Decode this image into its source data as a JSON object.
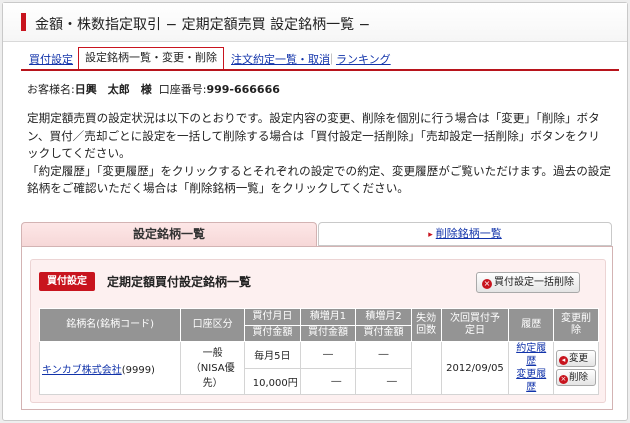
{
  "page": {
    "title": "金額・株数指定取引 − 定期定額売買 設定銘柄一覧 −"
  },
  "tabs": {
    "buy_settings": "買付設定",
    "active": "設定銘柄一覧・変更・削除",
    "order_list": "注文約定一覧・取消",
    "ranking": "ランキング",
    "sep": "｜"
  },
  "account": {
    "label": "お客様名:",
    "name": "日興　太郎　様",
    "number_label": "口座番号:",
    "number": "999-666666"
  },
  "description": {
    "p1": "定期定額売買の設定状況は以下のとおりです。設定内容の変更、削除を個別に行う場合は「変更」「削除」ボタン、買付／売却ごとに設定を一括して削除する場合は「買付設定一括削除」「売却設定一括削除」ボタンをクリックしてください。",
    "p2": "「約定履歴」「変更履歴」をクリックするとそれぞれの設定での約定、変更履歴がご覧いただけます。過去の設定銘柄をご確認いただく場合は「削除銘柄一覧」をクリックしてください。"
  },
  "section_tabs": {
    "current": "設定銘柄一覧",
    "deleted": "削除銘柄一覧",
    "arrow": "▸"
  },
  "panel": {
    "badge": "買付設定",
    "title": "定期定額買付設定銘柄一覧",
    "bulk_delete": "買付設定一括削除",
    "icon_x": "×"
  },
  "table": {
    "headers": {
      "stock": "銘柄名(銘柄コード)",
      "account_type": "口座区分",
      "buy_day": "買付月日",
      "increase1": "積増月1",
      "increase2": "積増月2",
      "expired": "失効回数",
      "next_buy": "次回買付予定日",
      "history": "履歴",
      "modify_delete": "変更削除",
      "amount": "買付金額"
    },
    "rows": [
      {
        "stock_name": "キンカブ株式会社",
        "stock_code": "(9999)",
        "account_type_1": "一般",
        "account_type_2": "（NISA優先）",
        "buy_day": "毎月5日",
        "amount": "10,000円",
        "increase1_month": "―",
        "increase1_amount": "―",
        "increase2_month": "―",
        "increase2_amount": "―",
        "expired": "",
        "next_buy": "2012/09/05",
        "hist_exec": "約定履歴",
        "hist_change": "変更履歴",
        "btn_change": "変更",
        "btn_delete": "削除"
      }
    ]
  },
  "colors": {
    "accent": "#c8141e",
    "header_gray": "#949494",
    "panel_pink": "#fdf0f0",
    "link": "#1133aa"
  }
}
